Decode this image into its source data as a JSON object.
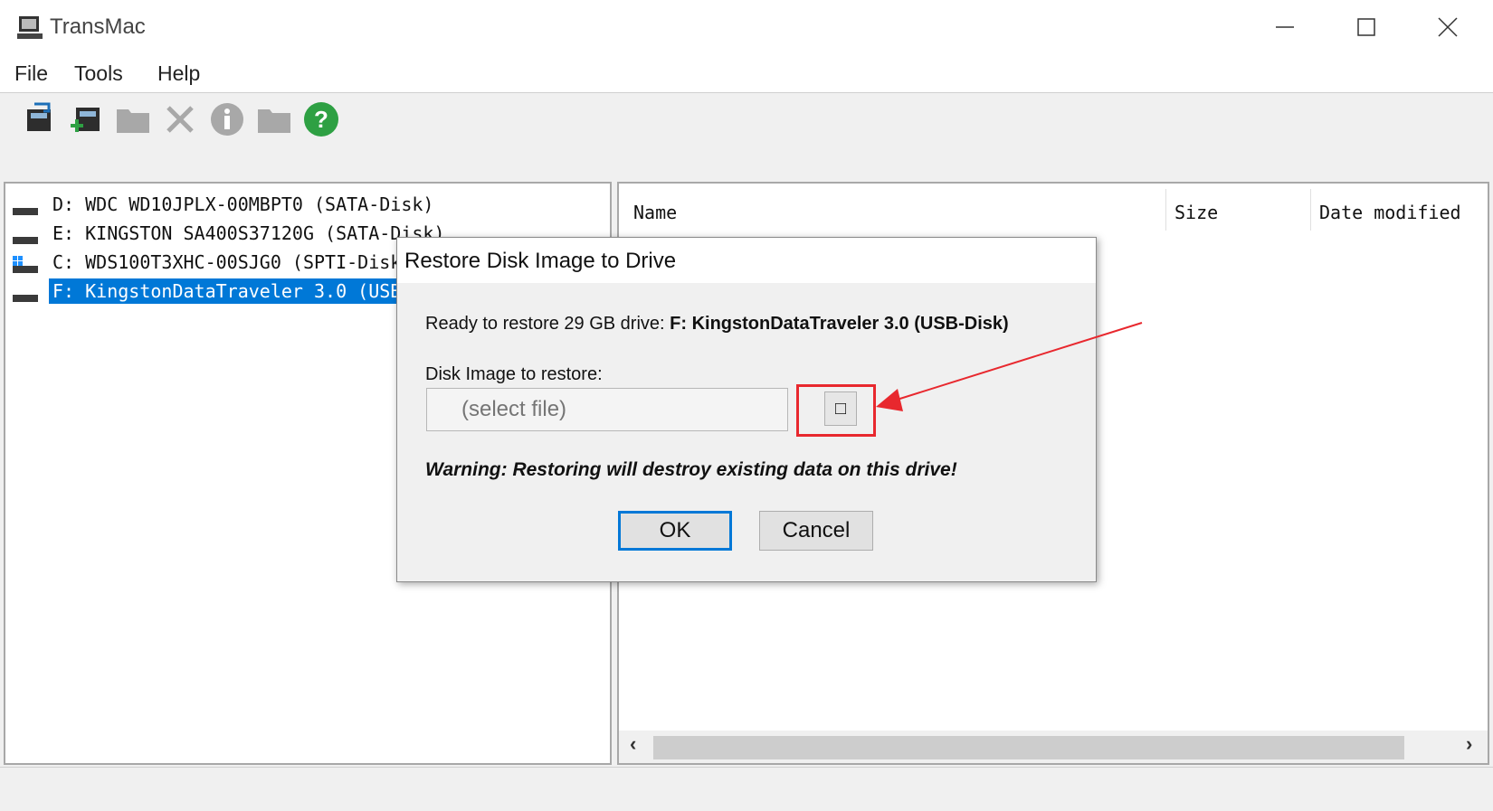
{
  "window": {
    "title": "TransMac",
    "controls": [
      "minimize",
      "maximize",
      "close"
    ]
  },
  "menu": {
    "items": [
      "File",
      "Tools",
      "Help"
    ]
  },
  "toolbar": {
    "icons": [
      "restore-disk-image-icon",
      "add-drive-icon",
      "folder-icon",
      "delete-icon",
      "info-icon",
      "folder-icon",
      "help-icon"
    ]
  },
  "drives": [
    {
      "label": "D:  WDC WD10JPLX-00MBPT0 (SATA-Disk)",
      "selected": false
    },
    {
      "label": "E:  KINGSTON SA400S37120G (SATA-Disk)",
      "selected": false
    },
    {
      "label": "C:  WDS100T3XHC-00SJG0 (SPTI-Disk)",
      "selected": false
    },
    {
      "label": "F:  KingstonDataTraveler 3.0 (USB-Disk)",
      "selected": true
    }
  ],
  "file_list": {
    "columns": [
      "Name",
      "Size",
      "Date modified"
    ]
  },
  "dialog": {
    "title": "Restore Disk Image to Drive",
    "ready_prefix": "Ready to restore 29 GB drive: ",
    "ready_drive": "F: KingstonDataTraveler 3.0 (USB-Disk)",
    "field_label": "Disk Image to restore:",
    "file_placeholder": "(select file)",
    "browse_label": "□",
    "warning": "Warning: Restoring will destroy existing data on this drive!",
    "ok_label": "OK",
    "cancel_label": "Cancel"
  },
  "colors": {
    "selection": "#0078d7",
    "annotation": "#e8282e"
  }
}
